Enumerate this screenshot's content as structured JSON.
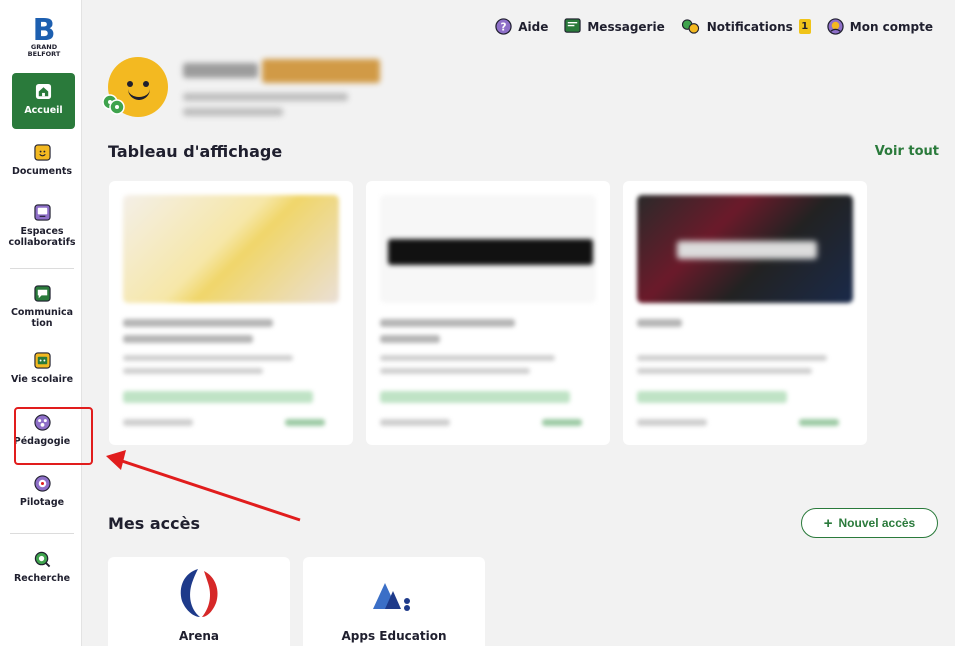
{
  "logo": {
    "letter": "B",
    "line1": "GRAND",
    "line2": "BELFORT"
  },
  "sidebar": {
    "items": [
      {
        "label": "Accueil",
        "icon": "home-icon"
      },
      {
        "label": "Documents",
        "icon": "documents-icon"
      },
      {
        "label": "Espaces collaboratifs",
        "icon": "collaborative-spaces-icon"
      },
      {
        "label": "Communica tion",
        "icon": "communication-icon"
      },
      {
        "label": "Vie scolaire",
        "icon": "school-life-icon"
      },
      {
        "label": "Pédagogie",
        "icon": "pedagogy-icon"
      },
      {
        "label": "Pilotage",
        "icon": "steering-icon"
      },
      {
        "label": "Recherche",
        "icon": "search-icon"
      }
    ],
    "active": "Accueil",
    "highlighted": "Pédagogie"
  },
  "topbar": {
    "help": "Aide",
    "messaging": "Messagerie",
    "notifications": "Notifications",
    "notifications_count": "1",
    "account": "Mon compte"
  },
  "board": {
    "title": "Tableau d'affichage",
    "see_all": "Voir tout"
  },
  "access": {
    "title": "Mes accès",
    "new_button": "Nouvel accès",
    "items": [
      {
        "label": "Arena",
        "icon": "arena-logo-icon"
      },
      {
        "label": "Apps Education",
        "icon": "apps-education-logo-icon"
      }
    ]
  },
  "colors": {
    "primary_green": "#2a7a3b",
    "annotation_red": "#e11d1d",
    "brand_blue": "#1d5fb0",
    "avatar_yellow": "#f3b921"
  }
}
